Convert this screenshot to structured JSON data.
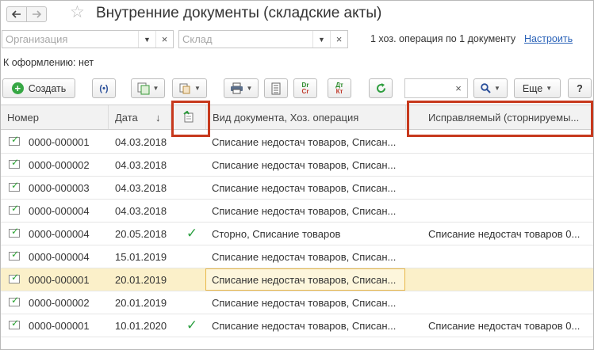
{
  "window": {
    "title": "Внутренние документы (складские акты)",
    "back_icon": "arrow-left-icon",
    "forward_icon": "arrow-right-icon",
    "favorite_icon": "star-icon"
  },
  "filters": {
    "organization_placeholder": "Организация",
    "warehouse_placeholder": "Склад",
    "ops_info": "1 хоз. операция по 1 документу",
    "configure_link": "Настроить"
  },
  "status": {
    "to_process": "К оформлению: нет"
  },
  "toolbar": {
    "create_label": "Создать",
    "more_label": "Еще",
    "help_label": "?"
  },
  "table": {
    "columns": {
      "number": "Номер",
      "date": "Дата",
      "sort_indicator": "↓",
      "doc_kind": "Вид документа, Хоз. операция",
      "corrected": "Исправляемый (сторнируемы..."
    },
    "rows": [
      {
        "number": "0000-000001",
        "date": "04.03.2018",
        "posted": "",
        "kind": "Списание недостач товаров, Списан...",
        "corrected": ""
      },
      {
        "number": "0000-000002",
        "date": "04.03.2018",
        "posted": "",
        "kind": "Списание недостач товаров, Списан...",
        "corrected": ""
      },
      {
        "number": "0000-000003",
        "date": "04.03.2018",
        "posted": "",
        "kind": "Списание недостач товаров, Списан...",
        "corrected": ""
      },
      {
        "number": "0000-000004",
        "date": "04.03.2018",
        "posted": "",
        "kind": "Списание недостач товаров, Списан...",
        "corrected": ""
      },
      {
        "number": "0000-000004",
        "date": "20.05.2018",
        "posted": "✓",
        "kind": "Сторно, Списание товаров",
        "corrected": "Списание недостач товаров 0..."
      },
      {
        "number": "0000-000004",
        "date": "15.01.2019",
        "posted": "",
        "kind": "Списание недостач товаров, Списан...",
        "corrected": ""
      },
      {
        "number": "0000-000001",
        "date": "20.01.2019",
        "posted": "",
        "kind": "Списание недостач товаров, Списан...",
        "corrected": ""
      },
      {
        "number": "0000-000002",
        "date": "20.01.2019",
        "posted": "",
        "kind": "Списание недостач товаров, Списан...",
        "corrected": ""
      },
      {
        "number": "0000-000001",
        "date": "10.01.2020",
        "posted": "✓",
        "kind": "Списание недостач товаров, Списан...",
        "corrected": "Списание недостач товаров 0..."
      }
    ]
  },
  "colors": {
    "accent_green": "#36a744",
    "highlight_red": "#c7391d",
    "selection_bg": "#fbf0c9",
    "link": "#2a62b8"
  }
}
